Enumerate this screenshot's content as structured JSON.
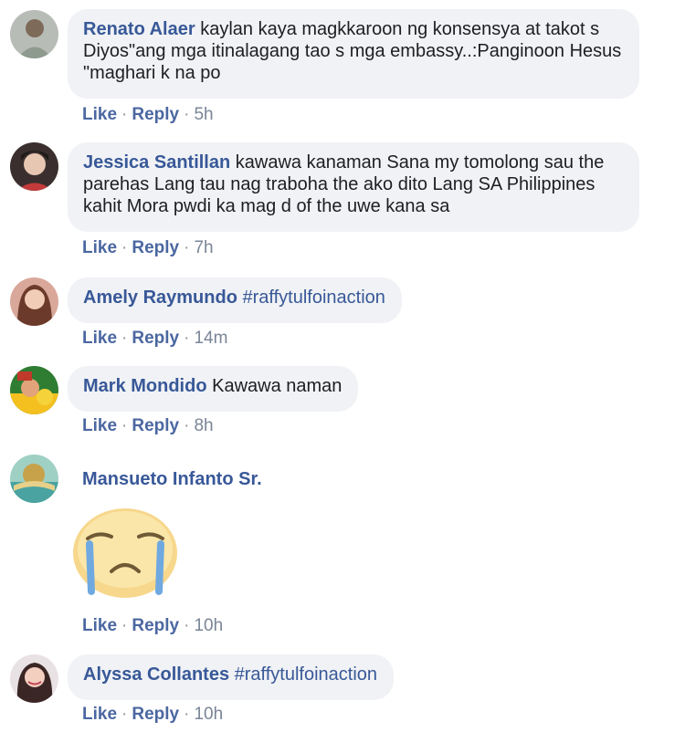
{
  "actions": {
    "like": "Like",
    "reply": "Reply",
    "sep": "·"
  },
  "comments": [
    {
      "author": "Renato Alaer",
      "text": "kaylan kaya magkkaroon ng konsensya at takot s Diyos\"ang mga itinalagang tao s mga embassy..:Panginoon Hesus \"maghari k na po",
      "time": "5h"
    },
    {
      "author": "Jessica Santillan",
      "text": "kawawa kanaman Sana my tomolong sau the parehas Lang tau nag traboha the ako dito Lang SA Philippines kahit Mora pwdi ka mag d of the uwe kana sa",
      "time": "7h"
    },
    {
      "author": "Amely Raymundo",
      "text": "#raffytulfoinaction",
      "time": "14m"
    },
    {
      "author": "Mark Mondido",
      "text": "Kawawa naman",
      "time": "8h"
    },
    {
      "author": "Mansueto Infanto Sr.",
      "sticker": "crying-face-sticker",
      "time": "10h"
    },
    {
      "author": "Alyssa Collantes",
      "text": "#raffytulfoinaction",
      "time": "10h"
    }
  ],
  "colors": {
    "author": "#385898",
    "bubble": "#f0f2f5",
    "action_link": "#4b67a1"
  }
}
